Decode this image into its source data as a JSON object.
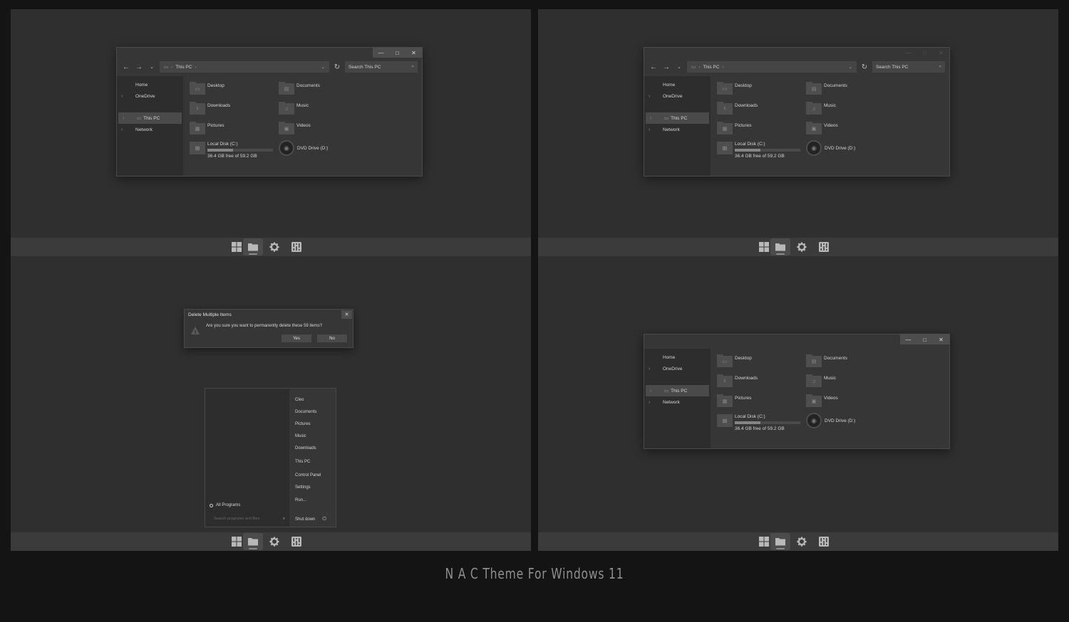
{
  "caption": "N A C Theme For Windows 11",
  "explorer": {
    "address": "This PC",
    "search_placeholder": "Search This PC",
    "sidebar": [
      "Home",
      "OneDrive",
      "This PC",
      "Network"
    ],
    "folders": [
      "Desktop",
      "Documents",
      "Downloads",
      "Music",
      "Pictures",
      "Videos"
    ],
    "local_disk": {
      "name": "Local Disk (C:)",
      "free": "36.4 GB free of 59.2 GB",
      "used_fraction": 0.39
    },
    "dvd": "DVD Drive (D:)"
  },
  "dialog": {
    "title": "Delete Multiple Items",
    "message": "Are you sure you want to permanently delete these 59 items?",
    "yes": "Yes",
    "no": "No"
  },
  "startmenu": {
    "items": [
      "Cleo",
      "Documents",
      "Pictures",
      "Music",
      "Downloads",
      "This PC",
      "Control Panel",
      "Settings",
      "Run..."
    ],
    "all_programs": "All Programs",
    "search_placeholder": "Search programs and files",
    "shutdown": "Shut down"
  },
  "taskbar_icons": [
    "start-icon",
    "file-explorer-icon",
    "settings-icon",
    "control-panel-icon"
  ]
}
